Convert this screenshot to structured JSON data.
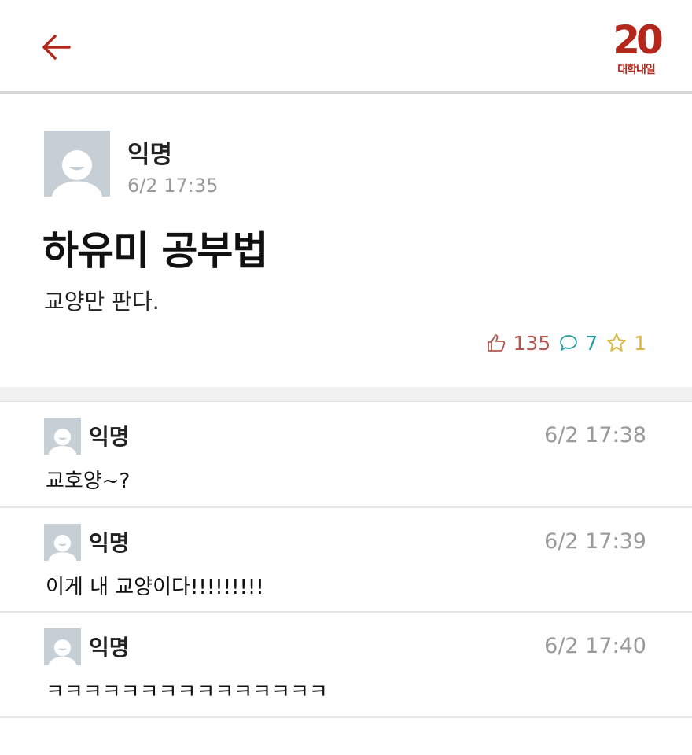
{
  "header": {
    "back_icon": "arrow-left-icon",
    "logo_number": "20",
    "logo_text": "대학내일",
    "accent_color": "#b3271c"
  },
  "post": {
    "author": "익명",
    "time": "6/2 17:35",
    "title": "하유미 공부법",
    "body": "교양만 판다.",
    "likes": "135",
    "comments": "7",
    "scraps": "1"
  },
  "comments": [
    {
      "author": "익명",
      "time": "6/2 17:38",
      "text": "교호양~?"
    },
    {
      "author": "익명",
      "time": "6/2 17:39",
      "text": "이게 내 교양이다!!!!!!!!!"
    },
    {
      "author": "익명",
      "time": "6/2 17:40",
      "text": "ㅋㅋㅋㅋㅋㅋㅋㅋㅋㅋㅋㅋㅋㅋㅋ"
    }
  ]
}
